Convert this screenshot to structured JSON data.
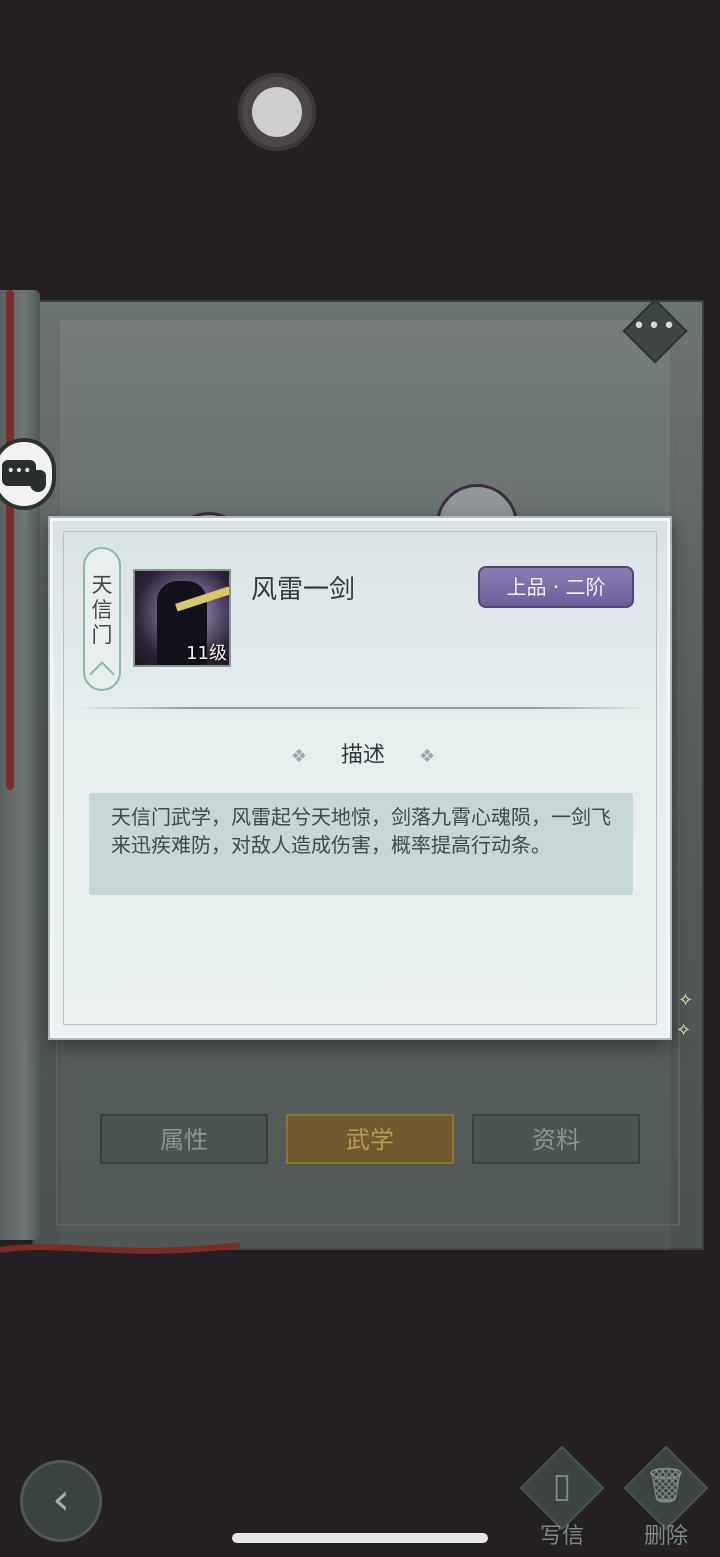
{
  "skill": {
    "sect": "天信门",
    "name": "风雷一剑",
    "level": "11级",
    "grade": "上品 · 二阶"
  },
  "description": {
    "title": "描述",
    "text": "天信门武学，风雷起兮天地惊，剑落九霄心魂陨，一剑飞来迅疾难防，对敌人造成伤害，概率提高行动条。"
  },
  "tabs": [
    {
      "label": "属性",
      "active": false
    },
    {
      "label": "武学",
      "active": true
    },
    {
      "label": "资料",
      "active": false
    }
  ],
  "actions": {
    "write_letter": "写信",
    "delete": "删除"
  },
  "icons": {
    "back": "back-arrow-icon",
    "menu": "more-dots-icon",
    "chat": "chat-icon",
    "letter": "letter-icon",
    "trash": "trash-icon"
  },
  "colors": {
    "background": "#231f22",
    "modal": "#e6eeee",
    "grade_badge": "#7b6da8",
    "active_tab": "#6e5a2e"
  }
}
